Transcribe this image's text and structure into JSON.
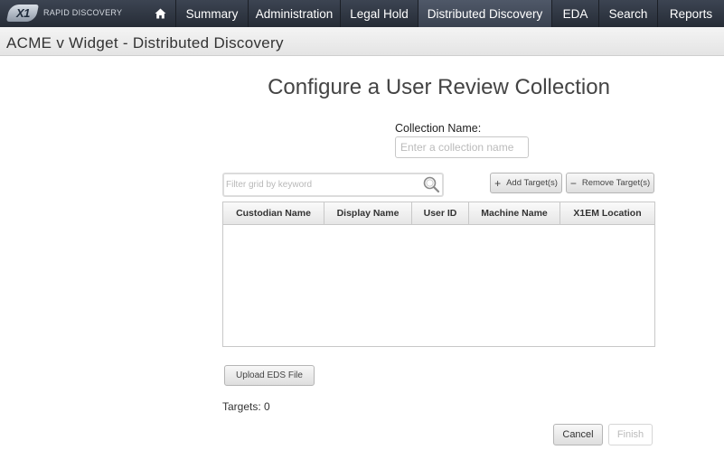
{
  "nav": {
    "logo_mark": "X1",
    "logo_text": "RAPID DISCOVERY",
    "home_icon": "home-icon",
    "items": [
      {
        "label": "Summary",
        "active": false
      },
      {
        "label": "Administration",
        "active": false
      },
      {
        "label": "Legal Hold",
        "active": false
      },
      {
        "label": "Distributed Discovery",
        "active": true
      },
      {
        "label": "EDA",
        "active": false
      },
      {
        "label": "Search",
        "active": false
      },
      {
        "label": "Reports",
        "active": false
      }
    ]
  },
  "page": {
    "breadcrumb": "ACME v Widget - Distributed Discovery",
    "title": "Configure a User Review Collection"
  },
  "collection": {
    "label": "Collection Name:",
    "placeholder": "Enter a collection name",
    "value": ""
  },
  "filter": {
    "placeholder": "Filter grid by keyword",
    "icon": "search-icon"
  },
  "buttons": {
    "add_target": "Add Target(s)",
    "add_glyph": "+",
    "remove_target": "Remove Target(s)",
    "remove_glyph": "−",
    "upload": "Upload EDS File",
    "cancel": "Cancel",
    "finish": "Finish"
  },
  "grid": {
    "columns": [
      "Custodian Name",
      "Display Name",
      "User ID",
      "Machine Name",
      "X1EM Location"
    ],
    "rows": []
  },
  "targets": {
    "text": "Targets: 0"
  },
  "colors": {
    "nav_bg": "#2e3440",
    "nav_active": "#4a5262",
    "header_bg": "#ececec"
  }
}
